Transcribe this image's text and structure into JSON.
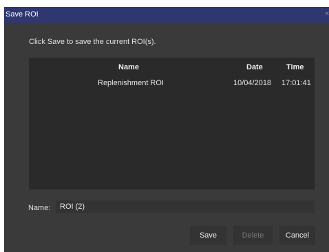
{
  "window": {
    "title": "Save ROI",
    "close_glyph": "×"
  },
  "instruction": "Click Save to save the current ROI(s).",
  "table": {
    "columns": [
      "Name",
      "Date",
      "Time"
    ],
    "rows": [
      {
        "name": "Replenishment ROI",
        "date": "10/04/2018",
        "time": "17:01:41"
      }
    ]
  },
  "name_field": {
    "label": "Name:",
    "value": "ROI (2)"
  },
  "buttons": {
    "save": "Save",
    "delete": "Delete",
    "cancel": "Cancel"
  },
  "colors": {
    "titlebar": "#2f3770",
    "dialog_background": "#3a3a3a",
    "table_background": "#2a2a2a"
  }
}
